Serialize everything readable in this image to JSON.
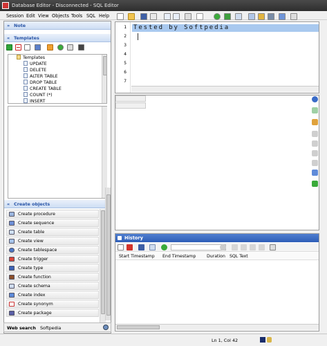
{
  "window": {
    "title": "Database Editor - Disconnected - SQL Editor"
  },
  "menu": [
    "Session",
    "Edit",
    "View",
    "Objects",
    "Tools",
    "SQL",
    "Help"
  ],
  "panels": {
    "note": "Note",
    "templates": "Templates",
    "create_objects": "Create objects"
  },
  "templates": {
    "root": "Templates",
    "items": [
      "UPDATE",
      "DELETE",
      "ALTER TABLE",
      "DROP TABLE",
      "CREATE TABLE",
      "COUNT (*)",
      "INSERT"
    ]
  },
  "create_objects": [
    "Create procedure",
    "Create sequence",
    "Create table",
    "Create view",
    "Create tablespace",
    "Create trigger",
    "Create type",
    "Create function",
    "Create schema",
    "Create index",
    "Create synonym",
    "Create package"
  ],
  "web_search": {
    "label": "Web search",
    "value": "Softpedia"
  },
  "editor": {
    "line1": "Tested by Softpedia",
    "line_numbers": [
      "1",
      "2",
      "3",
      "4",
      "5",
      "6",
      "7"
    ]
  },
  "history": {
    "title": "History",
    "columns": [
      "Start Timestamp",
      "End Timestamp",
      "Duration",
      "SQL Text"
    ]
  },
  "status": {
    "position": "Ln 1, Col 42"
  },
  "colors": {
    "accent": "#2d5db7",
    "panel_header": "#2a56a8",
    "selection": "#a9c9ef"
  }
}
